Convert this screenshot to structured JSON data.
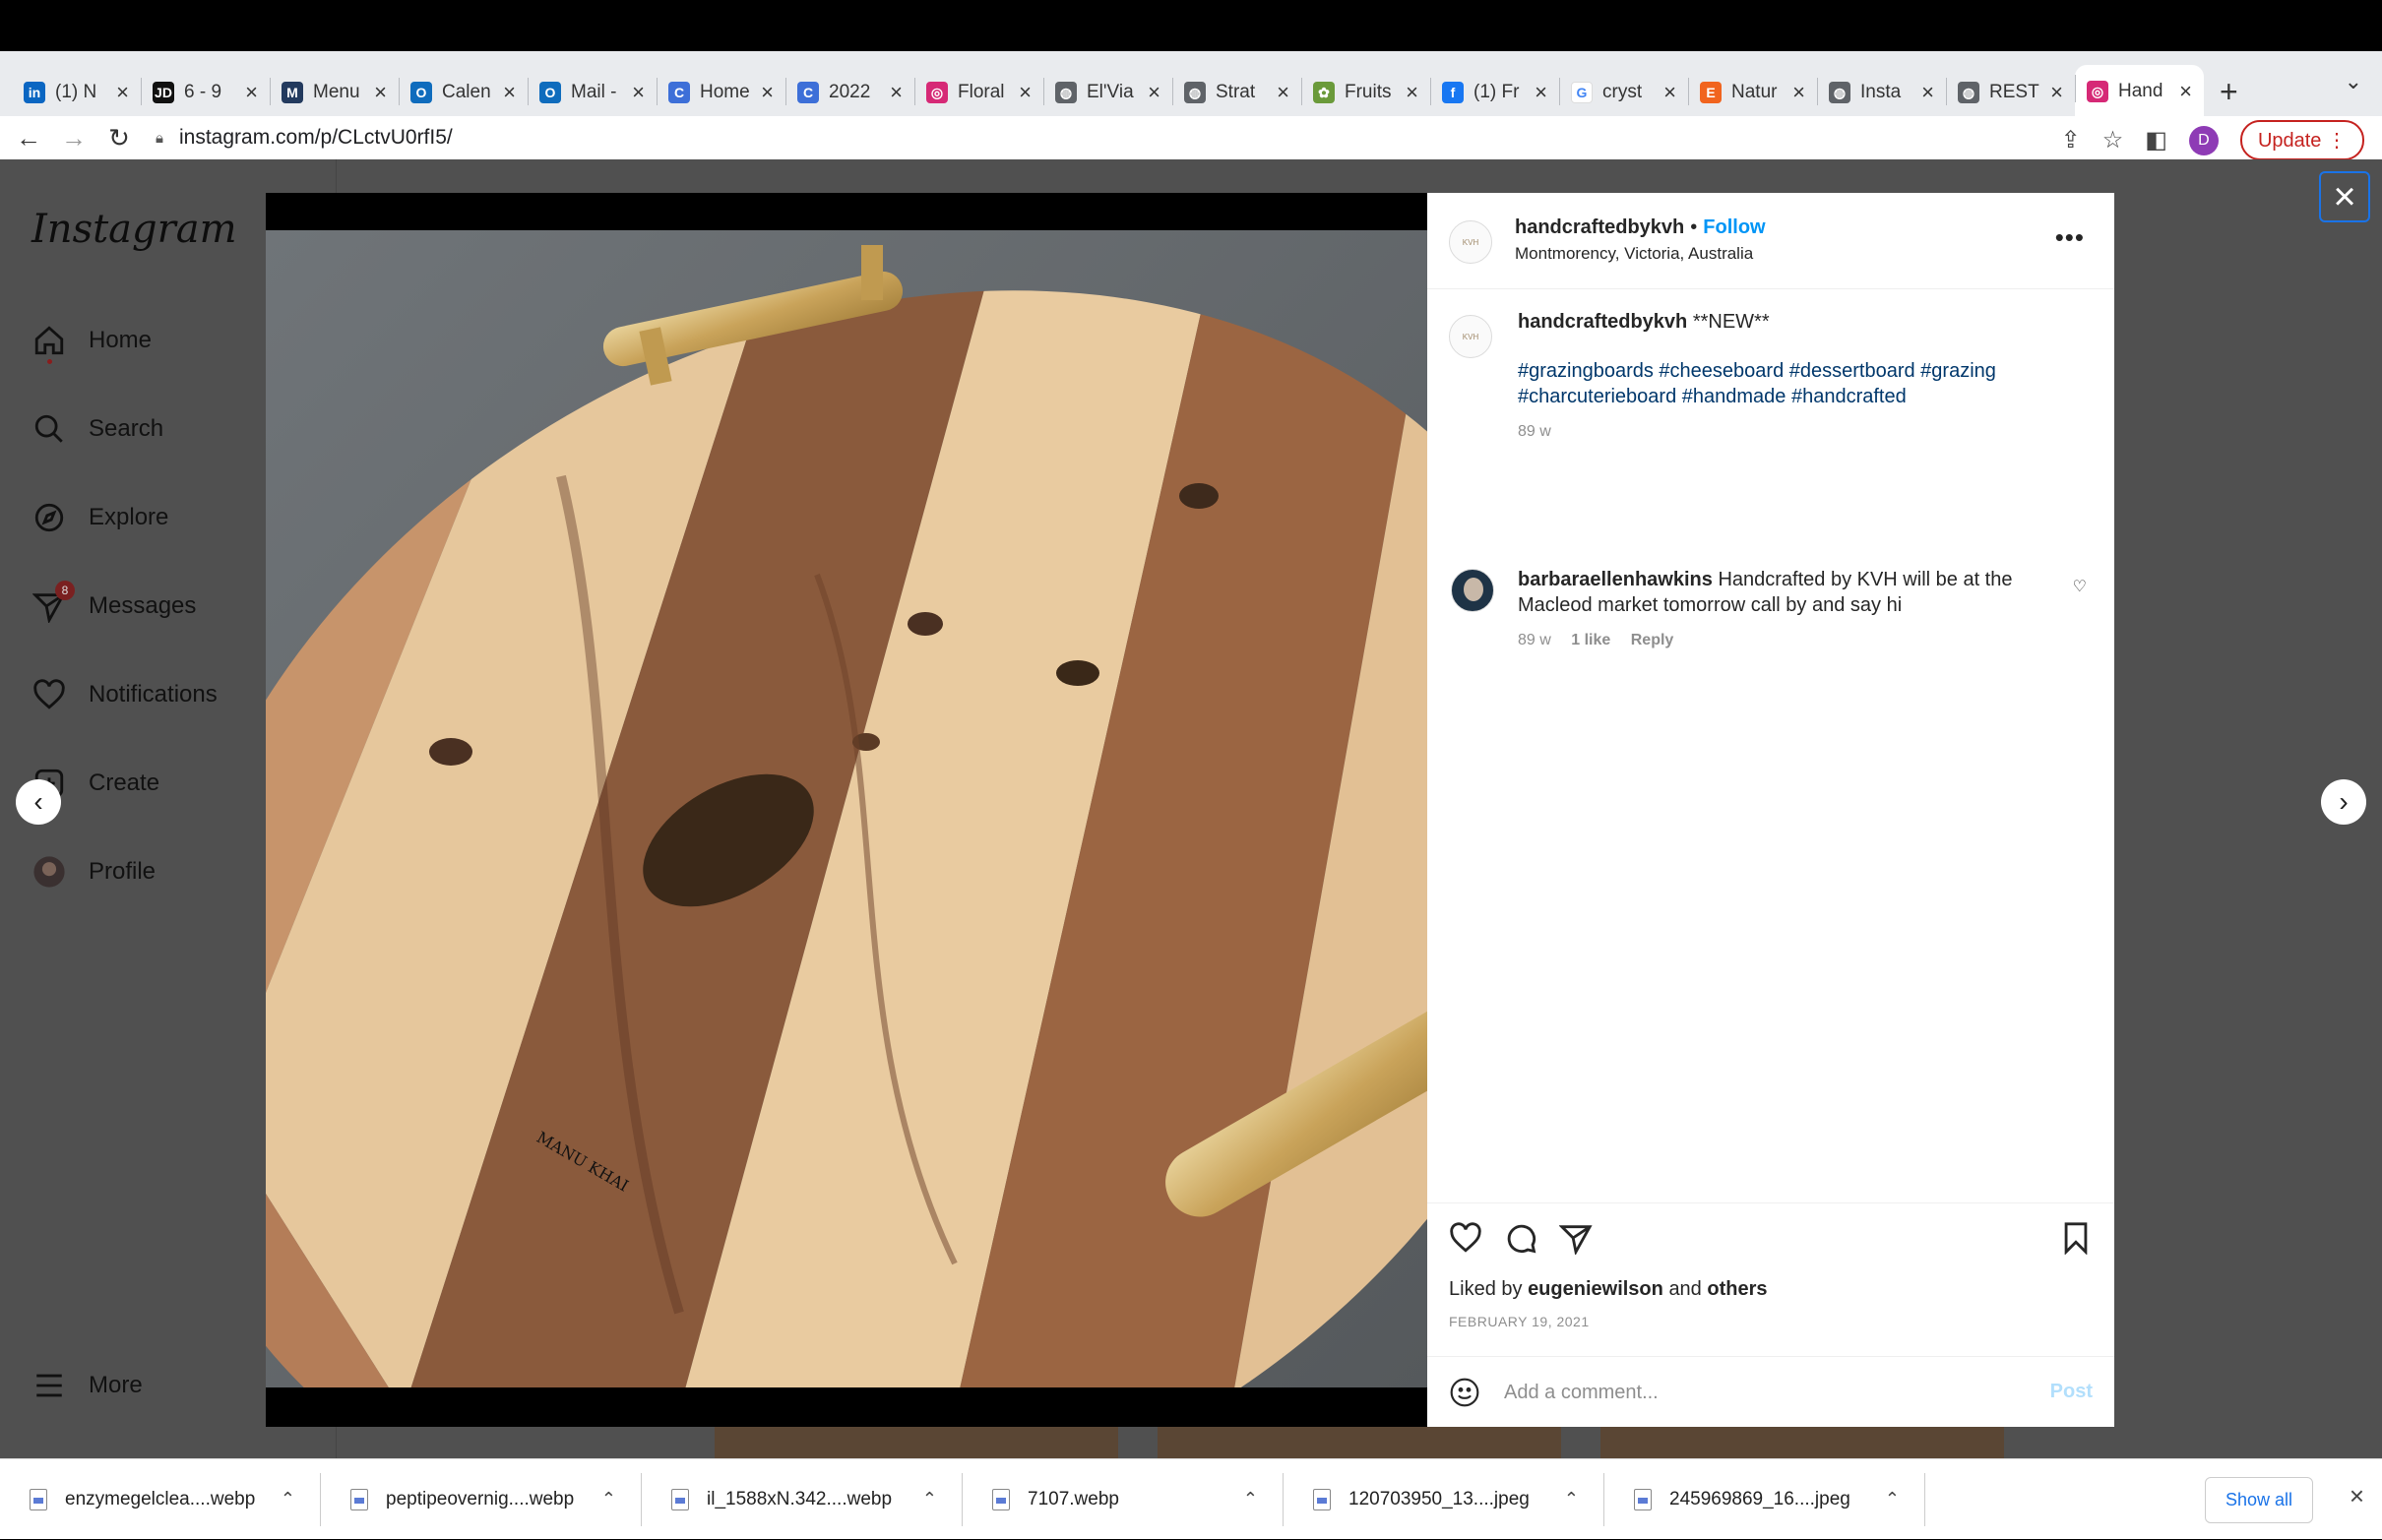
{
  "browser": {
    "tabs": [
      {
        "icon": "linkedin-icon",
        "title": "(1) N",
        "color": "#0a66c2",
        "glyph": "in"
      },
      {
        "icon": "jd-icon",
        "title": "6 - 9",
        "color": "#111111",
        "glyph": "JD"
      },
      {
        "icon": "menu-app-icon",
        "title": "Menu",
        "color": "#233a5e",
        "glyph": "M"
      },
      {
        "icon": "outlook-calendar-icon",
        "title": "Calen",
        "color": "#0f6cbd",
        "glyph": "O"
      },
      {
        "icon": "outlook-mail-icon",
        "title": "Mail -",
        "color": "#0f6cbd",
        "glyph": "O"
      },
      {
        "icon": "canva-icon",
        "title": "Home",
        "color": "#3d6fd8",
        "glyph": "C"
      },
      {
        "icon": "canva-icon",
        "title": "2022",
        "color": "#3d6fd8",
        "glyph": "C"
      },
      {
        "icon": "instagram-icon",
        "title": "Floral",
        "color": "#d62976",
        "glyph": "◎"
      },
      {
        "icon": "globe-icon",
        "title": "El'Via",
        "color": "#5f6368",
        "glyph": "◍"
      },
      {
        "icon": "globe-icon",
        "title": "Strat",
        "color": "#5f6368",
        "glyph": "◍"
      },
      {
        "icon": "fruits-icon",
        "title": "Fruits",
        "color": "#6a9a3a",
        "glyph": "✿"
      },
      {
        "icon": "facebook-icon",
        "title": "(1) Fr",
        "color": "#1877f2",
        "glyph": "f"
      },
      {
        "icon": "google-icon",
        "title": "cryst",
        "color": "#ffffff",
        "glyph": "G"
      },
      {
        "icon": "etsy-icon",
        "title": "Natur",
        "color": "#f1641e",
        "glyph": "E"
      },
      {
        "icon": "globe-icon",
        "title": "Insta",
        "color": "#5f6368",
        "glyph": "◍"
      },
      {
        "icon": "globe-icon",
        "title": "REST",
        "color": "#5f6368",
        "glyph": "◍"
      },
      {
        "icon": "instagram-icon",
        "title": "Hand",
        "color": "#d62976",
        "glyph": "◎",
        "active": true
      }
    ],
    "url": "instagram.com/p/CLctvU0rfI5/",
    "profile_initial": "D",
    "update_label": "Update"
  },
  "sidebar": {
    "logo": "Instagram",
    "items": [
      {
        "label": "Home",
        "icon": "home-icon"
      },
      {
        "label": "Search",
        "icon": "search-icon"
      },
      {
        "label": "Explore",
        "icon": "compass-icon"
      },
      {
        "label": "Messages",
        "icon": "messenger-icon",
        "badge": "8"
      },
      {
        "label": "Notifications",
        "icon": "heart-icon"
      },
      {
        "label": "Create",
        "icon": "plus-square-icon"
      },
      {
        "label": "Profile",
        "icon": "avatar-icon"
      }
    ],
    "more_label": "More"
  },
  "post": {
    "username": "handcraftedbykvh",
    "follow_label": "Follow",
    "location": "Montmorency, Victoria, Australia",
    "caption_title": "**NEW**",
    "caption_tags": "#grazingboards #cheeseboard #dessertboard #grazing #charcuterieboard #handmade #handcrafted",
    "caption_age": "89 w",
    "comment": {
      "username": "barbaraellenhawkins",
      "text": "Handcrafted by KVH will be at the Macleod market tomorrow call by and say hi",
      "age": "89 w",
      "likes": "1 like",
      "reply_label": "Reply"
    },
    "liked_by_prefix": "Liked by",
    "liked_by_user": "eugeniewilson",
    "liked_by_and": "and",
    "liked_by_others": "others",
    "date": "FEBRUARY 19, 2021",
    "comment_placeholder": "Add a comment...",
    "post_label": "Post"
  },
  "downloads": {
    "items": [
      "enzymegelclea....webp",
      "peptipeovernig....webp",
      "il_1588xN.342....webp",
      "7107.webp",
      "120703950_13....jpeg",
      "245969869_16....jpeg"
    ],
    "show_all_label": "Show all"
  }
}
